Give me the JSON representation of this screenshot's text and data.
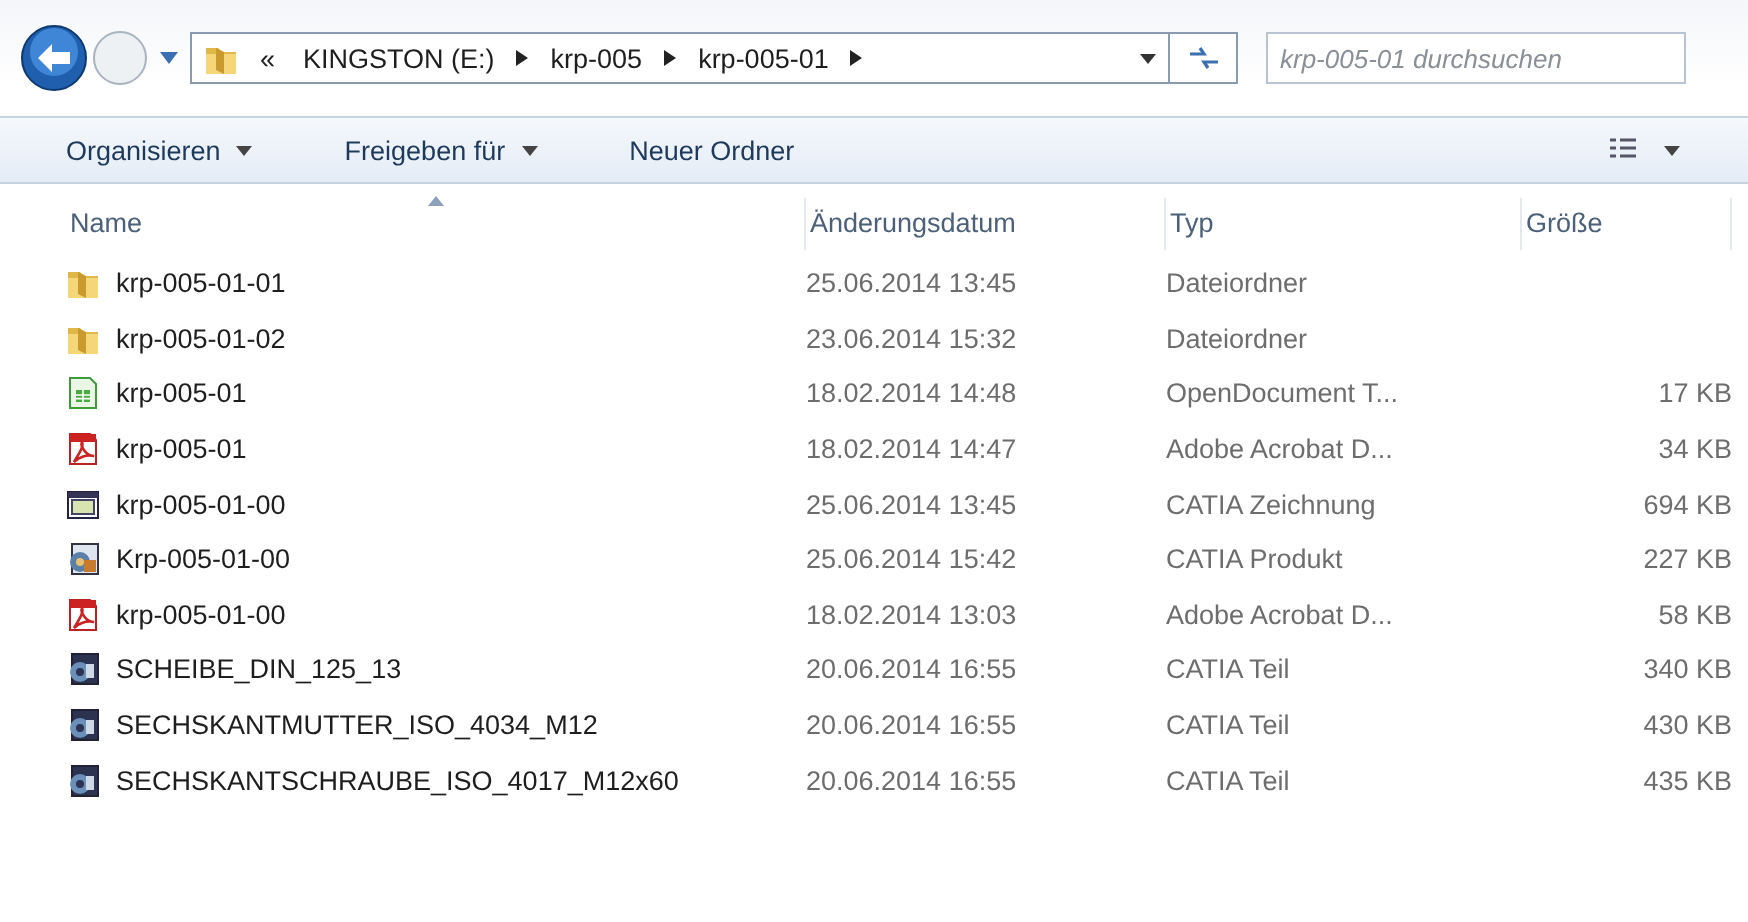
{
  "address_bar": {
    "overflow": "«",
    "crumbs": [
      "KINGSTON (E:)",
      "krp-005",
      "krp-005-01"
    ]
  },
  "search": {
    "placeholder": "krp-005-01 durchsuchen"
  },
  "toolbar": {
    "items": [
      {
        "label": "Organisieren",
        "dropdown": true
      },
      {
        "label": "Freigeben für",
        "dropdown": true
      },
      {
        "label": "Neuer Ordner",
        "dropdown": false
      }
    ]
  },
  "table": {
    "columns": [
      "Name",
      "Änderungsdatum",
      "Typ",
      "Größe"
    ],
    "rows": [
      {
        "kind": "folder",
        "name": "krp-005-01-01",
        "date": "25.06.2014 13:45",
        "type": "Dateiordner"
      },
      {
        "kind": "folder",
        "name": "krp-005-01-02",
        "date": "23.06.2014 15:32",
        "type": "Dateiordner"
      },
      {
        "kind": "spreadsheet",
        "name": "krp-005-01",
        "date": "18.02.2014 14:48",
        "type": "OpenDocument T...",
        "size": "17 KB"
      },
      {
        "kind": "pdf",
        "name": "krp-005-01",
        "date": "18.02.2014 14:47",
        "type": "Adobe Acrobat D...",
        "size": "34 KB"
      },
      {
        "kind": "drawing",
        "name": "krp-005-01-00",
        "date": "25.06.2014 13:45",
        "type": "CATIA Zeichnung",
        "size": "694 KB"
      },
      {
        "kind": "product",
        "name": "Krp-005-01-00",
        "date": "25.06.2014 15:42",
        "type": "CATIA Produkt",
        "size": "227 KB"
      },
      {
        "kind": "pdf",
        "name": "krp-005-01-00",
        "date": "18.02.2014 13:03",
        "type": "Adobe Acrobat D...",
        "size": "58 KB"
      },
      {
        "kind": "part",
        "name": "SCHEIBE_DIN_125_13",
        "date": "20.06.2014 16:55",
        "type": "CATIA Teil",
        "size": "340 KB"
      },
      {
        "kind": "part",
        "name": "SECHSKANTMUTTER_ISO_4034_M12",
        "date": "20.06.2014 16:55",
        "type": "CATIA Teil",
        "size": "430 KB"
      },
      {
        "kind": "part",
        "name": "SECHSKANTSCHRAUBE_ISO_4017_M12x60",
        "date": "20.06.2014 16:55",
        "type": "CATIA Teil",
        "size": "435 KB"
      }
    ]
  }
}
